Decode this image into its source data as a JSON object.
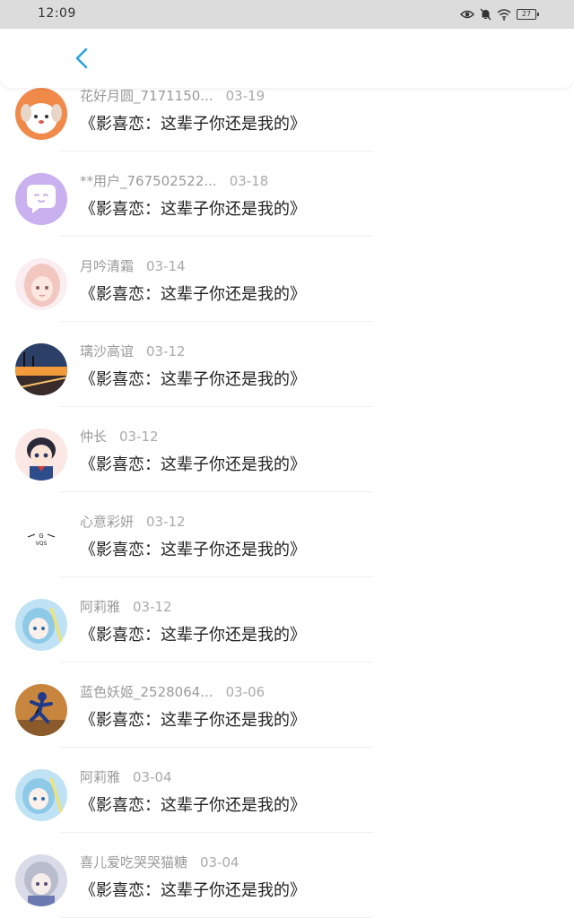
{
  "status_bar": {
    "time": "12:09",
    "battery": "27"
  },
  "header": {
    "back_icon": "chevron-left-icon",
    "accent": "#2aa2e0"
  },
  "comments": [
    {
      "user": "花好月圆_7171150...",
      "date": "03-19",
      "text": "《影喜恋：这辈子你还是我的》",
      "avatar": "cartoon-dog"
    },
    {
      "user": "**用户_767502522...",
      "date": "03-18",
      "text": "《影喜恋：这辈子你还是我的》",
      "avatar": "default-purple"
    },
    {
      "user": "月吟清霜",
      "date": "03-14",
      "text": "《影喜恋：这辈子你还是我的》",
      "avatar": "anime-girl-pink"
    },
    {
      "user": "璃沙高谊",
      "date": "03-12",
      "text": "《影喜恋：这辈子你还是我的》",
      "avatar": "sunset-road"
    },
    {
      "user": "仲长",
      "date": "03-12",
      "text": "《影喜恋：这辈子你还是我的》",
      "avatar": "anime-boy"
    },
    {
      "user": "心意彩妍",
      "date": "03-12",
      "text": "《影喜恋：这辈子你还是我的》",
      "avatar": "logo-vqs"
    },
    {
      "user": "阿莉雅",
      "date": "03-12",
      "text": "《影喜恋：这辈子你还是我的》",
      "avatar": "anime-blue"
    },
    {
      "user": "蓝色妖姬_2528064...",
      "date": "03-06",
      "text": "《影喜恋：这辈子你还是我的》",
      "avatar": "runner"
    },
    {
      "user": "阿莉雅",
      "date": "03-04",
      "text": "《影喜恋：这辈子你还是我的》",
      "avatar": "anime-blue"
    },
    {
      "user": "喜儿爱吃哭哭猫糖",
      "date": "03-04",
      "text": "《影喜恋：这辈子你还是我的》",
      "avatar": "anime-silver"
    }
  ],
  "avatar_logo_text": {
    "top": "G",
    "bottom": "VQS"
  }
}
